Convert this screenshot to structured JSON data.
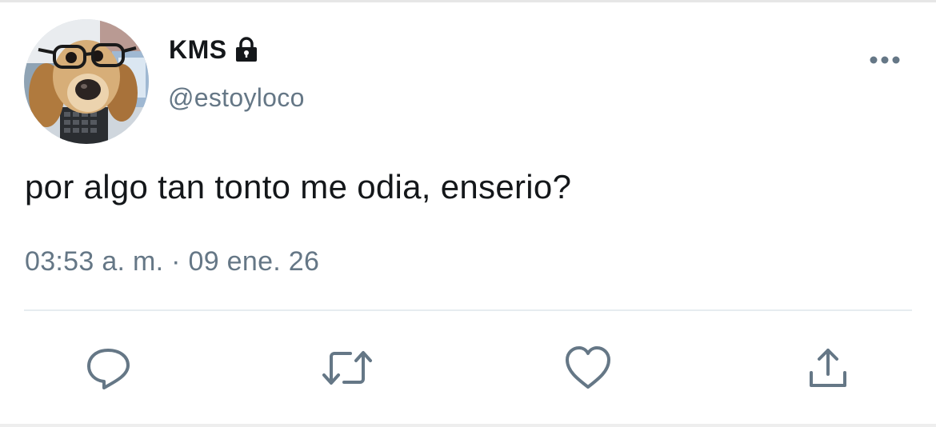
{
  "tweet": {
    "display_name": "KMS",
    "handle": "@estoyloco",
    "text": "por algo tan tonto me odia, enserio?",
    "timestamp": "03:53 a. m. · 09 ene. 26",
    "protected": true
  },
  "icons": {
    "lock": "lock-icon",
    "more": "more-horizontal-icon",
    "reply": "reply-bubble-icon",
    "retweet": "retweet-icon",
    "like": "heart-icon",
    "share": "share-upload-icon"
  },
  "colors": {
    "name": "#14171a",
    "secondary": "#657786",
    "divider": "#e6ecf0",
    "icon": "#657786"
  }
}
